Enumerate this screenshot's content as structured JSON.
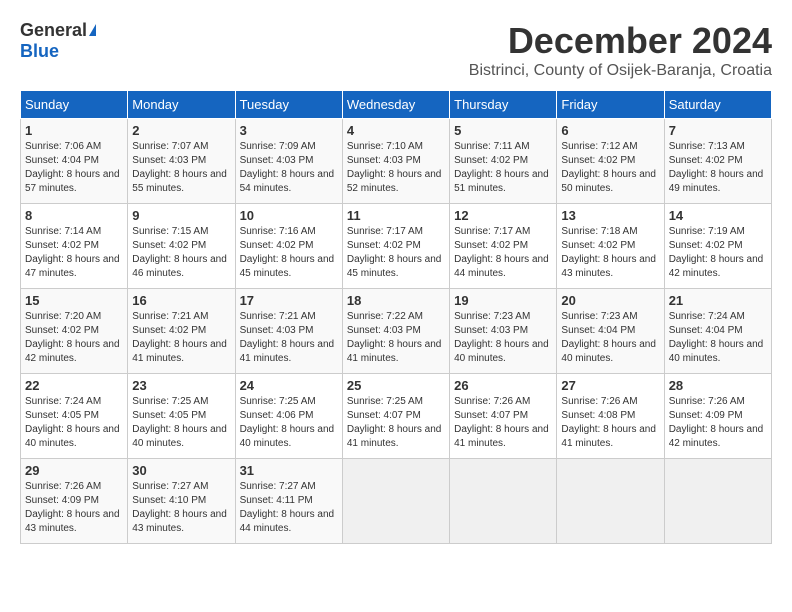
{
  "logo": {
    "general": "General",
    "blue": "Blue"
  },
  "title": {
    "month_year": "December 2024",
    "location": "Bistrinci, County of Osijek-Baranja, Croatia"
  },
  "headers": [
    "Sunday",
    "Monday",
    "Tuesday",
    "Wednesday",
    "Thursday",
    "Friday",
    "Saturday"
  ],
  "weeks": [
    [
      {
        "day": "1",
        "sunrise": "7:06 AM",
        "sunset": "4:04 PM",
        "daylight": "8 hours and 57 minutes."
      },
      {
        "day": "2",
        "sunrise": "7:07 AM",
        "sunset": "4:03 PM",
        "daylight": "8 hours and 55 minutes."
      },
      {
        "day": "3",
        "sunrise": "7:09 AM",
        "sunset": "4:03 PM",
        "daylight": "8 hours and 54 minutes."
      },
      {
        "day": "4",
        "sunrise": "7:10 AM",
        "sunset": "4:03 PM",
        "daylight": "8 hours and 52 minutes."
      },
      {
        "day": "5",
        "sunrise": "7:11 AM",
        "sunset": "4:02 PM",
        "daylight": "8 hours and 51 minutes."
      },
      {
        "day": "6",
        "sunrise": "7:12 AM",
        "sunset": "4:02 PM",
        "daylight": "8 hours and 50 minutes."
      },
      {
        "day": "7",
        "sunrise": "7:13 AM",
        "sunset": "4:02 PM",
        "daylight": "8 hours and 49 minutes."
      }
    ],
    [
      {
        "day": "8",
        "sunrise": "7:14 AM",
        "sunset": "4:02 PM",
        "daylight": "8 hours and 47 minutes."
      },
      {
        "day": "9",
        "sunrise": "7:15 AM",
        "sunset": "4:02 PM",
        "daylight": "8 hours and 46 minutes."
      },
      {
        "day": "10",
        "sunrise": "7:16 AM",
        "sunset": "4:02 PM",
        "daylight": "8 hours and 45 minutes."
      },
      {
        "day": "11",
        "sunrise": "7:17 AM",
        "sunset": "4:02 PM",
        "daylight": "8 hours and 45 minutes."
      },
      {
        "day": "12",
        "sunrise": "7:17 AM",
        "sunset": "4:02 PM",
        "daylight": "8 hours and 44 minutes."
      },
      {
        "day": "13",
        "sunrise": "7:18 AM",
        "sunset": "4:02 PM",
        "daylight": "8 hours and 43 minutes."
      },
      {
        "day": "14",
        "sunrise": "7:19 AM",
        "sunset": "4:02 PM",
        "daylight": "8 hours and 42 minutes."
      }
    ],
    [
      {
        "day": "15",
        "sunrise": "7:20 AM",
        "sunset": "4:02 PM",
        "daylight": "8 hours and 42 minutes."
      },
      {
        "day": "16",
        "sunrise": "7:21 AM",
        "sunset": "4:02 PM",
        "daylight": "8 hours and 41 minutes."
      },
      {
        "day": "17",
        "sunrise": "7:21 AM",
        "sunset": "4:03 PM",
        "daylight": "8 hours and 41 minutes."
      },
      {
        "day": "18",
        "sunrise": "7:22 AM",
        "sunset": "4:03 PM",
        "daylight": "8 hours and 41 minutes."
      },
      {
        "day": "19",
        "sunrise": "7:23 AM",
        "sunset": "4:03 PM",
        "daylight": "8 hours and 40 minutes."
      },
      {
        "day": "20",
        "sunrise": "7:23 AM",
        "sunset": "4:04 PM",
        "daylight": "8 hours and 40 minutes."
      },
      {
        "day": "21",
        "sunrise": "7:24 AM",
        "sunset": "4:04 PM",
        "daylight": "8 hours and 40 minutes."
      }
    ],
    [
      {
        "day": "22",
        "sunrise": "7:24 AM",
        "sunset": "4:05 PM",
        "daylight": "8 hours and 40 minutes."
      },
      {
        "day": "23",
        "sunrise": "7:25 AM",
        "sunset": "4:05 PM",
        "daylight": "8 hours and 40 minutes."
      },
      {
        "day": "24",
        "sunrise": "7:25 AM",
        "sunset": "4:06 PM",
        "daylight": "8 hours and 40 minutes."
      },
      {
        "day": "25",
        "sunrise": "7:25 AM",
        "sunset": "4:07 PM",
        "daylight": "8 hours and 41 minutes."
      },
      {
        "day": "26",
        "sunrise": "7:26 AM",
        "sunset": "4:07 PM",
        "daylight": "8 hours and 41 minutes."
      },
      {
        "day": "27",
        "sunrise": "7:26 AM",
        "sunset": "4:08 PM",
        "daylight": "8 hours and 41 minutes."
      },
      {
        "day": "28",
        "sunrise": "7:26 AM",
        "sunset": "4:09 PM",
        "daylight": "8 hours and 42 minutes."
      }
    ],
    [
      {
        "day": "29",
        "sunrise": "7:26 AM",
        "sunset": "4:09 PM",
        "daylight": "8 hours and 43 minutes."
      },
      {
        "day": "30",
        "sunrise": "7:27 AM",
        "sunset": "4:10 PM",
        "daylight": "8 hours and 43 minutes."
      },
      {
        "day": "31",
        "sunrise": "7:27 AM",
        "sunset": "4:11 PM",
        "daylight": "8 hours and 44 minutes."
      },
      null,
      null,
      null,
      null
    ]
  ]
}
